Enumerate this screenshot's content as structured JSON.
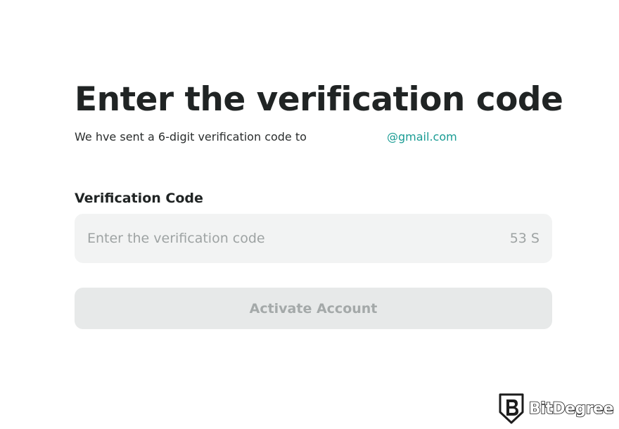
{
  "heading": "Enter the verification code",
  "subtitle": {
    "text": "We hve sent a 6-digit verification code to",
    "email": "@gmail.com",
    "email_color": "#1a9c94"
  },
  "verification": {
    "label": "Verification Code",
    "placeholder": "Enter the verification code",
    "value": "",
    "countdown": "53 S"
  },
  "actions": {
    "activate_label": "Activate Account",
    "activate_enabled": false
  },
  "watermark": {
    "brand": "BitDegree",
    "icon": "bitdegree-shield-logo"
  },
  "colors": {
    "accent": "#1a9c94",
    "button_disabled_bg": "#e7e9e9",
    "input_bg": "#f2f3f3"
  }
}
